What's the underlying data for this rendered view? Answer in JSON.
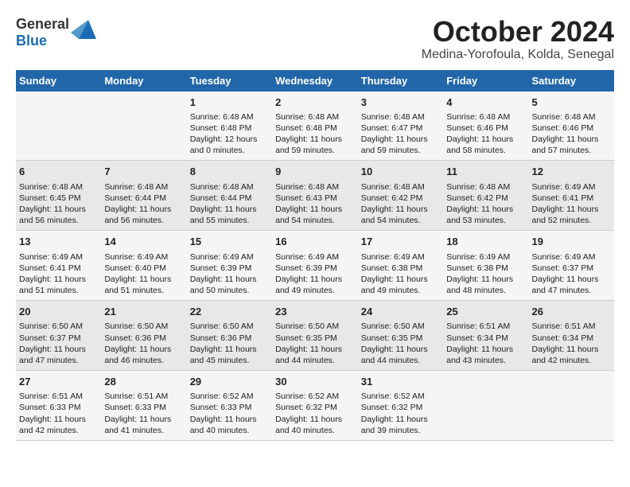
{
  "logo": {
    "general": "General",
    "blue": "Blue"
  },
  "title": "October 2024",
  "subtitle": "Medina-Yorofoula, Kolda, Senegal",
  "headers": [
    "Sunday",
    "Monday",
    "Tuesday",
    "Wednesday",
    "Thursday",
    "Friday",
    "Saturday"
  ],
  "weeks": [
    [
      {
        "day": "",
        "info": ""
      },
      {
        "day": "",
        "info": ""
      },
      {
        "day": "1",
        "info": "Sunrise: 6:48 AM\nSunset: 6:48 PM\nDaylight: 12 hours\nand 0 minutes."
      },
      {
        "day": "2",
        "info": "Sunrise: 6:48 AM\nSunset: 6:48 PM\nDaylight: 11 hours\nand 59 minutes."
      },
      {
        "day": "3",
        "info": "Sunrise: 6:48 AM\nSunset: 6:47 PM\nDaylight: 11 hours\nand 59 minutes."
      },
      {
        "day": "4",
        "info": "Sunrise: 6:48 AM\nSunset: 6:46 PM\nDaylight: 11 hours\nand 58 minutes."
      },
      {
        "day": "5",
        "info": "Sunrise: 6:48 AM\nSunset: 6:46 PM\nDaylight: 11 hours\nand 57 minutes."
      }
    ],
    [
      {
        "day": "6",
        "info": "Sunrise: 6:48 AM\nSunset: 6:45 PM\nDaylight: 11 hours\nand 56 minutes."
      },
      {
        "day": "7",
        "info": "Sunrise: 6:48 AM\nSunset: 6:44 PM\nDaylight: 11 hours\nand 56 minutes."
      },
      {
        "day": "8",
        "info": "Sunrise: 6:48 AM\nSunset: 6:44 PM\nDaylight: 11 hours\nand 55 minutes."
      },
      {
        "day": "9",
        "info": "Sunrise: 6:48 AM\nSunset: 6:43 PM\nDaylight: 11 hours\nand 54 minutes."
      },
      {
        "day": "10",
        "info": "Sunrise: 6:48 AM\nSunset: 6:42 PM\nDaylight: 11 hours\nand 54 minutes."
      },
      {
        "day": "11",
        "info": "Sunrise: 6:48 AM\nSunset: 6:42 PM\nDaylight: 11 hours\nand 53 minutes."
      },
      {
        "day": "12",
        "info": "Sunrise: 6:49 AM\nSunset: 6:41 PM\nDaylight: 11 hours\nand 52 minutes."
      }
    ],
    [
      {
        "day": "13",
        "info": "Sunrise: 6:49 AM\nSunset: 6:41 PM\nDaylight: 11 hours\nand 51 minutes."
      },
      {
        "day": "14",
        "info": "Sunrise: 6:49 AM\nSunset: 6:40 PM\nDaylight: 11 hours\nand 51 minutes."
      },
      {
        "day": "15",
        "info": "Sunrise: 6:49 AM\nSunset: 6:39 PM\nDaylight: 11 hours\nand 50 minutes."
      },
      {
        "day": "16",
        "info": "Sunrise: 6:49 AM\nSunset: 6:39 PM\nDaylight: 11 hours\nand 49 minutes."
      },
      {
        "day": "17",
        "info": "Sunrise: 6:49 AM\nSunset: 6:38 PM\nDaylight: 11 hours\nand 49 minutes."
      },
      {
        "day": "18",
        "info": "Sunrise: 6:49 AM\nSunset: 6:38 PM\nDaylight: 11 hours\nand 48 minutes."
      },
      {
        "day": "19",
        "info": "Sunrise: 6:49 AM\nSunset: 6:37 PM\nDaylight: 11 hours\nand 47 minutes."
      }
    ],
    [
      {
        "day": "20",
        "info": "Sunrise: 6:50 AM\nSunset: 6:37 PM\nDaylight: 11 hours\nand 47 minutes."
      },
      {
        "day": "21",
        "info": "Sunrise: 6:50 AM\nSunset: 6:36 PM\nDaylight: 11 hours\nand 46 minutes."
      },
      {
        "day": "22",
        "info": "Sunrise: 6:50 AM\nSunset: 6:36 PM\nDaylight: 11 hours\nand 45 minutes."
      },
      {
        "day": "23",
        "info": "Sunrise: 6:50 AM\nSunset: 6:35 PM\nDaylight: 11 hours\nand 44 minutes."
      },
      {
        "day": "24",
        "info": "Sunrise: 6:50 AM\nSunset: 6:35 PM\nDaylight: 11 hours\nand 44 minutes."
      },
      {
        "day": "25",
        "info": "Sunrise: 6:51 AM\nSunset: 6:34 PM\nDaylight: 11 hours\nand 43 minutes."
      },
      {
        "day": "26",
        "info": "Sunrise: 6:51 AM\nSunset: 6:34 PM\nDaylight: 11 hours\nand 42 minutes."
      }
    ],
    [
      {
        "day": "27",
        "info": "Sunrise: 6:51 AM\nSunset: 6:33 PM\nDaylight: 11 hours\nand 42 minutes."
      },
      {
        "day": "28",
        "info": "Sunrise: 6:51 AM\nSunset: 6:33 PM\nDaylight: 11 hours\nand 41 minutes."
      },
      {
        "day": "29",
        "info": "Sunrise: 6:52 AM\nSunset: 6:33 PM\nDaylight: 11 hours\nand 40 minutes."
      },
      {
        "day": "30",
        "info": "Sunrise: 6:52 AM\nSunset: 6:32 PM\nDaylight: 11 hours\nand 40 minutes."
      },
      {
        "day": "31",
        "info": "Sunrise: 6:52 AM\nSunset: 6:32 PM\nDaylight: 11 hours\nand 39 minutes."
      },
      {
        "day": "",
        "info": ""
      },
      {
        "day": "",
        "info": ""
      }
    ]
  ]
}
